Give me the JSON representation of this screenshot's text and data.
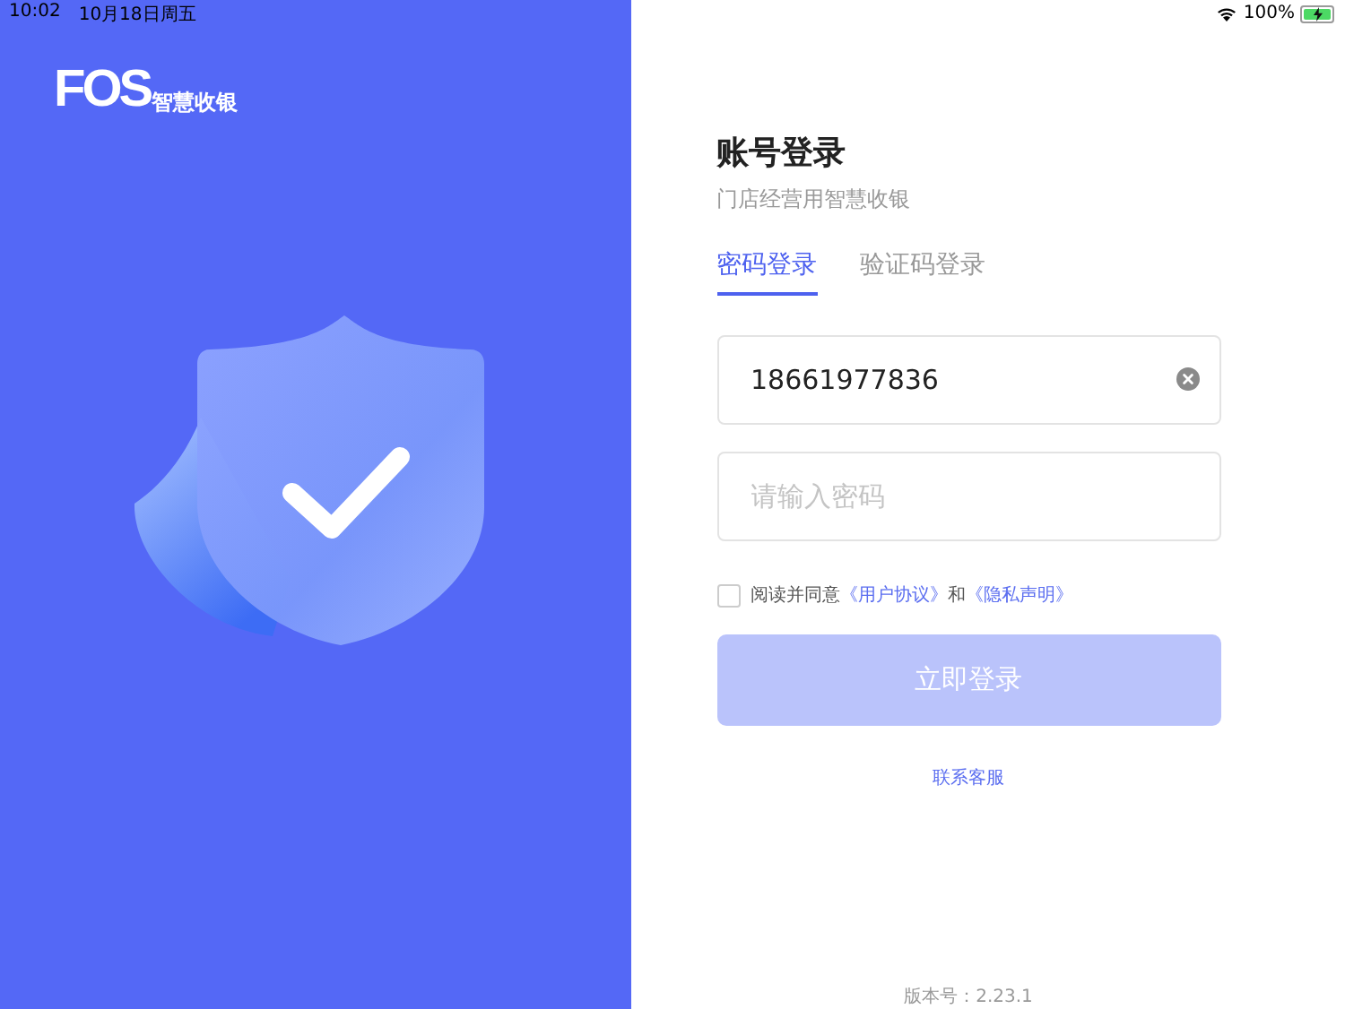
{
  "status_bar": {
    "time": "10:02",
    "date": "10月18日周五",
    "battery": "100%",
    "charging": true
  },
  "brand": {
    "logo": "FOS",
    "name": "智慧收银"
  },
  "login": {
    "title": "账号登录",
    "subtitle": "门店经营用智慧收银",
    "tabs": [
      {
        "label": "密码登录",
        "selected": true
      },
      {
        "label": "验证码登录",
        "selected": false
      }
    ],
    "phone_field": {
      "value": "18661977836",
      "clearable": true
    },
    "password_field": {
      "placeholder": "请输入密码"
    },
    "agreement": {
      "checked": false,
      "parts": [
        {
          "kind": "plain",
          "text": "阅读并同意"
        },
        {
          "kind": "link",
          "text": "《用户协议》"
        },
        {
          "kind": "plain",
          "text": "和"
        },
        {
          "kind": "link",
          "text": "《隐私声明》"
        }
      ]
    },
    "submit": {
      "label": "立即登录",
      "disabled": true
    },
    "contact_link": "联系客服",
    "version": "版本号：2.23.1"
  }
}
